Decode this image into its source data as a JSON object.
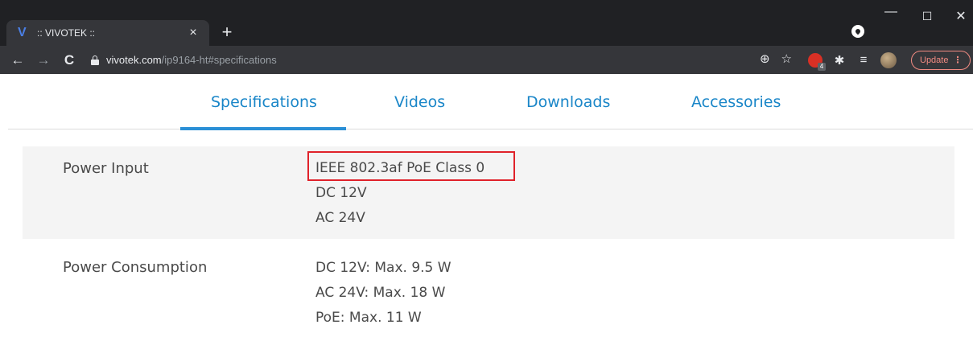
{
  "browser": {
    "tab": {
      "favicon": "V",
      "title": ":: VIVOTEK ::",
      "close_glyph": "×"
    },
    "new_tab_glyph": "+",
    "window": {
      "minimize": "—",
      "maximize": "☐",
      "close": "✕"
    },
    "toolbar": {
      "back": "←",
      "forward": "→",
      "reload": "C",
      "url_host": "vivotek.com",
      "url_path": "/ip9164-ht#specifications",
      "zoom_icon": "⊕",
      "star_icon": "☆",
      "extension_badge": "4",
      "puzzle_icon": "✱",
      "media_icon": "≡",
      "update_label": "Update",
      "update_menu": "⋮"
    }
  },
  "page": {
    "tabs": [
      {
        "label": "Specifications",
        "active": true
      },
      {
        "label": "Videos",
        "active": false
      },
      {
        "label": "Downloads",
        "active": false
      },
      {
        "label": "Accessories",
        "active": false
      }
    ],
    "specs": [
      {
        "label": "Power Input",
        "values": [
          "IEEE 802.3af PoE Class 0",
          "DC 12V",
          "AC 24V"
        ]
      },
      {
        "label": "Power Consumption",
        "values": [
          "DC 12V: Max. 9.5 W",
          "AC 24V: Max. 18 W",
          "PoE: Max. 11 W"
        ]
      }
    ]
  },
  "colors": {
    "tab_accent": "#1a86c8",
    "active_bar": "#2a8fd6",
    "highlight_box": "#e0222a",
    "update_red": "#f28b82"
  }
}
